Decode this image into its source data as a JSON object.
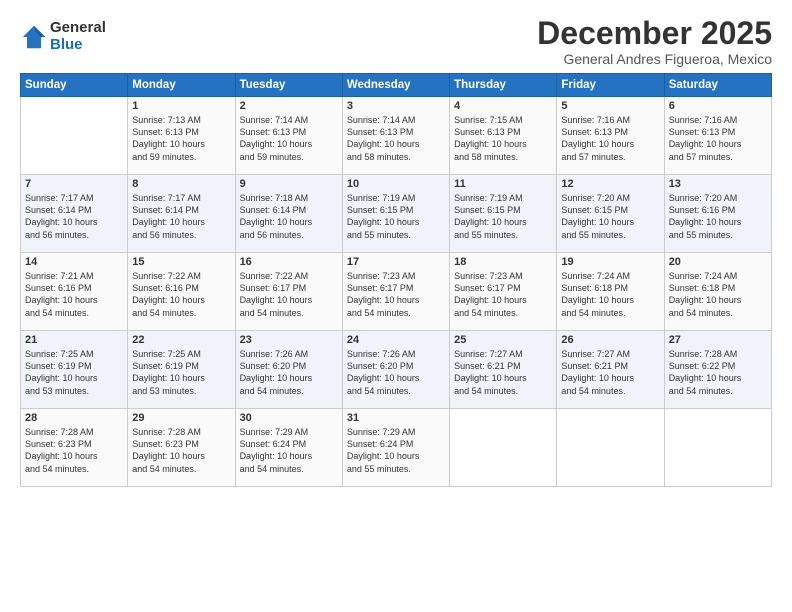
{
  "logo": {
    "general": "General",
    "blue": "Blue"
  },
  "title": "December 2025",
  "subtitle": "General Andres Figueroa, Mexico",
  "days_of_week": [
    "Sunday",
    "Monday",
    "Tuesday",
    "Wednesday",
    "Thursday",
    "Friday",
    "Saturday"
  ],
  "weeks": [
    [
      {
        "day": "",
        "info": ""
      },
      {
        "day": "1",
        "info": "Sunrise: 7:13 AM\nSunset: 6:13 PM\nDaylight: 10 hours\nand 59 minutes."
      },
      {
        "day": "2",
        "info": "Sunrise: 7:14 AM\nSunset: 6:13 PM\nDaylight: 10 hours\nand 59 minutes."
      },
      {
        "day": "3",
        "info": "Sunrise: 7:14 AM\nSunset: 6:13 PM\nDaylight: 10 hours\nand 58 minutes."
      },
      {
        "day": "4",
        "info": "Sunrise: 7:15 AM\nSunset: 6:13 PM\nDaylight: 10 hours\nand 58 minutes."
      },
      {
        "day": "5",
        "info": "Sunrise: 7:16 AM\nSunset: 6:13 PM\nDaylight: 10 hours\nand 57 minutes."
      },
      {
        "day": "6",
        "info": "Sunrise: 7:16 AM\nSunset: 6:13 PM\nDaylight: 10 hours\nand 57 minutes."
      }
    ],
    [
      {
        "day": "7",
        "info": "Sunrise: 7:17 AM\nSunset: 6:14 PM\nDaylight: 10 hours\nand 56 minutes."
      },
      {
        "day": "8",
        "info": "Sunrise: 7:17 AM\nSunset: 6:14 PM\nDaylight: 10 hours\nand 56 minutes."
      },
      {
        "day": "9",
        "info": "Sunrise: 7:18 AM\nSunset: 6:14 PM\nDaylight: 10 hours\nand 56 minutes."
      },
      {
        "day": "10",
        "info": "Sunrise: 7:19 AM\nSunset: 6:15 PM\nDaylight: 10 hours\nand 55 minutes."
      },
      {
        "day": "11",
        "info": "Sunrise: 7:19 AM\nSunset: 6:15 PM\nDaylight: 10 hours\nand 55 minutes."
      },
      {
        "day": "12",
        "info": "Sunrise: 7:20 AM\nSunset: 6:15 PM\nDaylight: 10 hours\nand 55 minutes."
      },
      {
        "day": "13",
        "info": "Sunrise: 7:20 AM\nSunset: 6:16 PM\nDaylight: 10 hours\nand 55 minutes."
      }
    ],
    [
      {
        "day": "14",
        "info": "Sunrise: 7:21 AM\nSunset: 6:16 PM\nDaylight: 10 hours\nand 54 minutes."
      },
      {
        "day": "15",
        "info": "Sunrise: 7:22 AM\nSunset: 6:16 PM\nDaylight: 10 hours\nand 54 minutes."
      },
      {
        "day": "16",
        "info": "Sunrise: 7:22 AM\nSunset: 6:17 PM\nDaylight: 10 hours\nand 54 minutes."
      },
      {
        "day": "17",
        "info": "Sunrise: 7:23 AM\nSunset: 6:17 PM\nDaylight: 10 hours\nand 54 minutes."
      },
      {
        "day": "18",
        "info": "Sunrise: 7:23 AM\nSunset: 6:17 PM\nDaylight: 10 hours\nand 54 minutes."
      },
      {
        "day": "19",
        "info": "Sunrise: 7:24 AM\nSunset: 6:18 PM\nDaylight: 10 hours\nand 54 minutes."
      },
      {
        "day": "20",
        "info": "Sunrise: 7:24 AM\nSunset: 6:18 PM\nDaylight: 10 hours\nand 54 minutes."
      }
    ],
    [
      {
        "day": "21",
        "info": "Sunrise: 7:25 AM\nSunset: 6:19 PM\nDaylight: 10 hours\nand 53 minutes."
      },
      {
        "day": "22",
        "info": "Sunrise: 7:25 AM\nSunset: 6:19 PM\nDaylight: 10 hours\nand 53 minutes."
      },
      {
        "day": "23",
        "info": "Sunrise: 7:26 AM\nSunset: 6:20 PM\nDaylight: 10 hours\nand 54 minutes."
      },
      {
        "day": "24",
        "info": "Sunrise: 7:26 AM\nSunset: 6:20 PM\nDaylight: 10 hours\nand 54 minutes."
      },
      {
        "day": "25",
        "info": "Sunrise: 7:27 AM\nSunset: 6:21 PM\nDaylight: 10 hours\nand 54 minutes."
      },
      {
        "day": "26",
        "info": "Sunrise: 7:27 AM\nSunset: 6:21 PM\nDaylight: 10 hours\nand 54 minutes."
      },
      {
        "day": "27",
        "info": "Sunrise: 7:28 AM\nSunset: 6:22 PM\nDaylight: 10 hours\nand 54 minutes."
      }
    ],
    [
      {
        "day": "28",
        "info": "Sunrise: 7:28 AM\nSunset: 6:23 PM\nDaylight: 10 hours\nand 54 minutes."
      },
      {
        "day": "29",
        "info": "Sunrise: 7:28 AM\nSunset: 6:23 PM\nDaylight: 10 hours\nand 54 minutes."
      },
      {
        "day": "30",
        "info": "Sunrise: 7:29 AM\nSunset: 6:24 PM\nDaylight: 10 hours\nand 54 minutes."
      },
      {
        "day": "31",
        "info": "Sunrise: 7:29 AM\nSunset: 6:24 PM\nDaylight: 10 hours\nand 55 minutes."
      },
      {
        "day": "",
        "info": ""
      },
      {
        "day": "",
        "info": ""
      },
      {
        "day": "",
        "info": ""
      }
    ]
  ]
}
